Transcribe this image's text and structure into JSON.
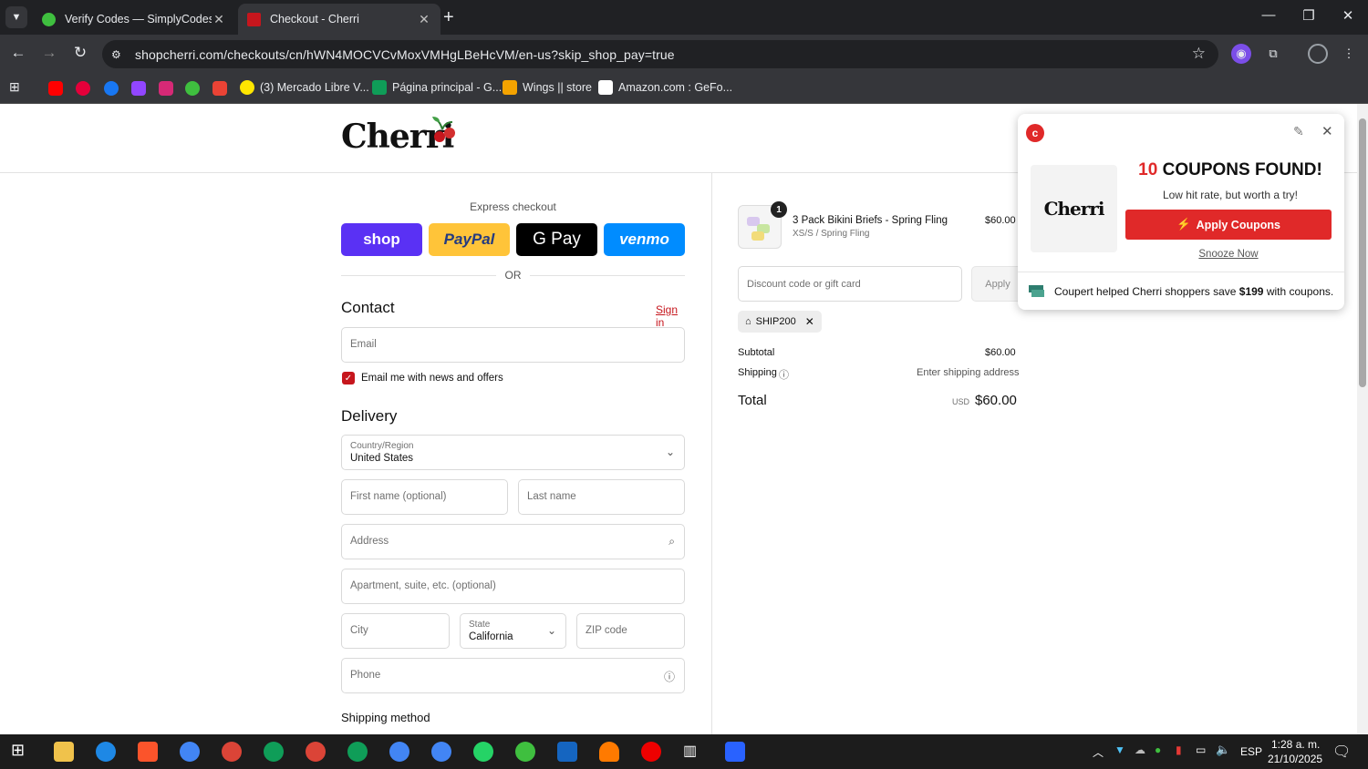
{
  "browser": {
    "tabs": [
      {
        "title": "Verify Codes — SimplyCodes",
        "favicon_color": "#3fbf3f"
      },
      {
        "title": "Checkout - Cherri",
        "favicon_color": "#c6161d"
      }
    ],
    "url": "shopcherri.com/checkouts/cn/hWN4MOCVCvMoxVMHgLBeHcVM/en-us?skip_shop_pay=true",
    "bookmarks": [
      "(3) Mercado Libre V...",
      "Página principal - G...",
      "Wings || store",
      "Amazon.com : GeFo..."
    ]
  },
  "store": {
    "logo": "Cherri"
  },
  "checkout": {
    "express_label": "Express checkout",
    "pay_buttons": {
      "shop": "shop",
      "paypal": "PayPal",
      "gpay": "G Pay",
      "venmo": "venmo"
    },
    "or": "OR",
    "contact": {
      "heading": "Contact",
      "sign_in": "Sign in",
      "email_placeholder": "Email",
      "newsletter_label": "Email me with news and offers",
      "newsletter_checked": true
    },
    "delivery": {
      "heading": "Delivery",
      "country_label": "Country/Region",
      "country_value": "United States",
      "first_name": "First name (optional)",
      "last_name": "Last name",
      "address": "Address",
      "apartment": "Apartment, suite, etc. (optional)",
      "city": "City",
      "state_label": "State",
      "state_value": "California",
      "zip": "ZIP code",
      "phone": "Phone"
    },
    "shipping_method_heading": "Shipping method"
  },
  "summary": {
    "item": {
      "qty": "1",
      "name": "3 Pack Bikini Briefs - Spring Fling",
      "variant": "XS/S / Spring Fling",
      "price": "$60.00"
    },
    "discount_placeholder": "Discount code or gift card",
    "apply": "Apply",
    "applied_code": "SHIP200",
    "subtotal_label": "Subtotal",
    "subtotal_value": "$60.00",
    "shipping_label": "Shipping",
    "shipping_value": "Enter shipping address",
    "total_label": "Total",
    "currency": "USD",
    "total_value": "$60.00"
  },
  "coupon_popup": {
    "logo": "Cherri",
    "count": "10",
    "found_text": "COUPONS FOUND!",
    "subtitle": "Low hit rate, but worth a try!",
    "cta": "Apply Coupons",
    "snooze": "Snooze Now",
    "footer_prefix": "Coupert helped Cherri shoppers save ",
    "footer_amount": "$199",
    "footer_suffix": " with coupons."
  },
  "taskbar": {
    "language": "ESP",
    "time": "1:28 a. m.",
    "date": "21/10/2025"
  },
  "colors": {
    "accent": "#c6161d",
    "shop": "#5a31f4",
    "paypal": "#ffc439",
    "venmo": "#008cff",
    "coupert_red": "#e02929"
  }
}
